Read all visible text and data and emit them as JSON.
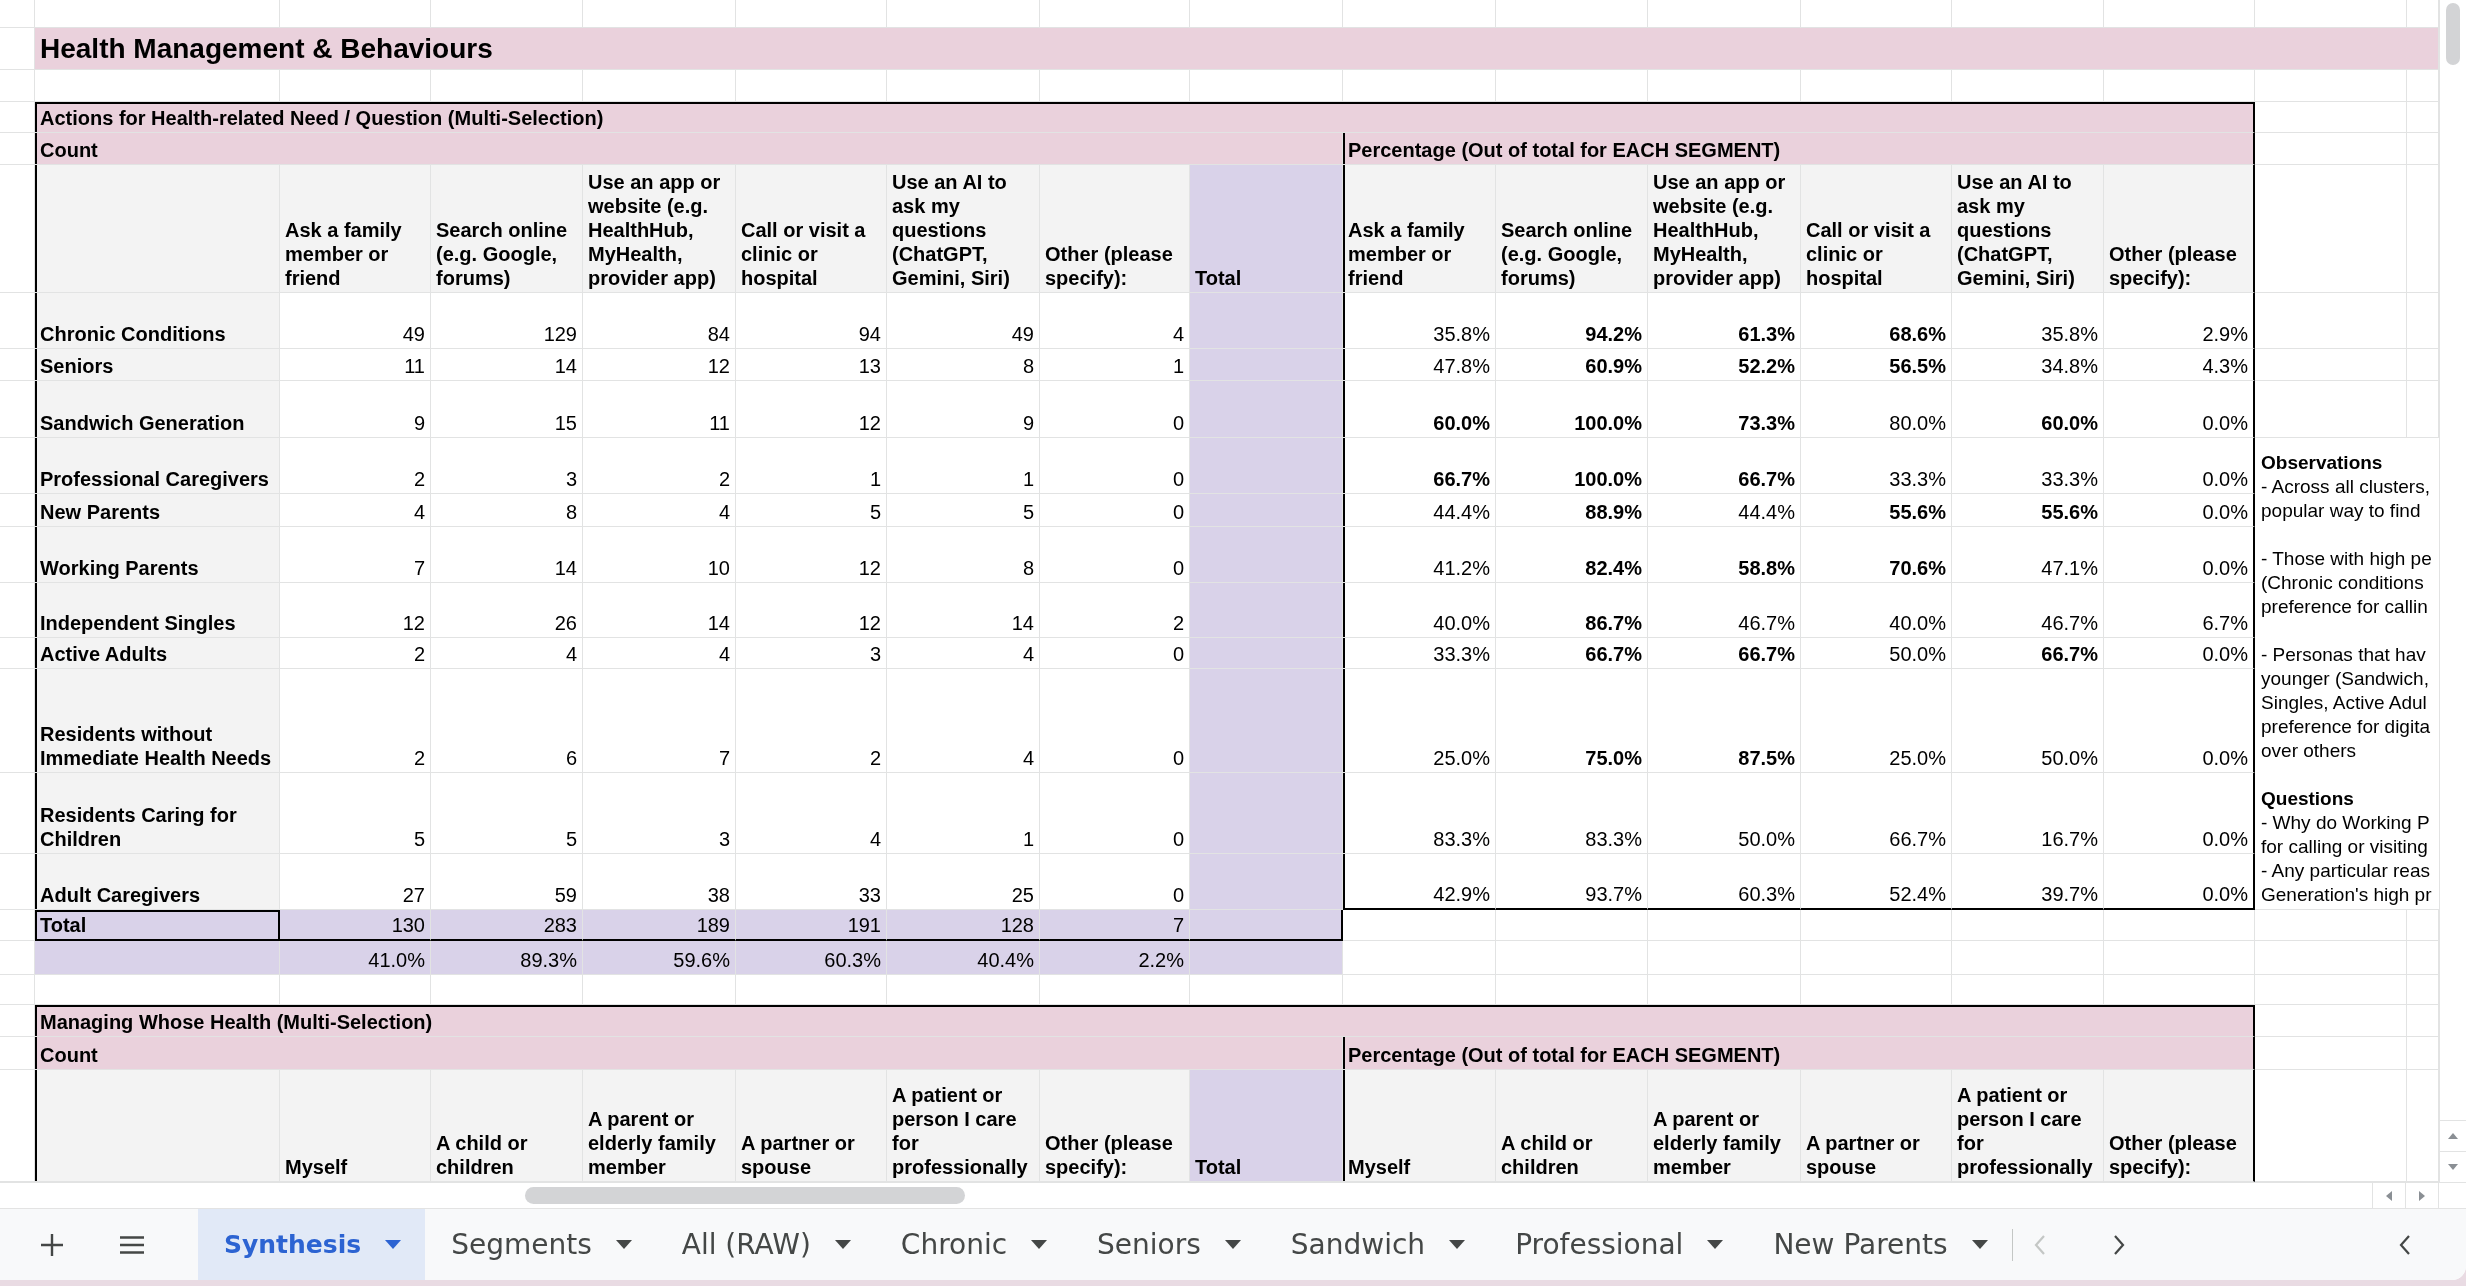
{
  "sheet": {
    "title": "Health Management & Behaviours",
    "tables": [
      {
        "title": "Actions for Health-related Need / Question (Multi-Selection)",
        "count_label": "Count",
        "percentage_label": "Percentage (Out of total for EACH SEGMENT)",
        "count_columns": [
          "Ask a family member or friend",
          "Search online (e.g. Google, forums)",
          "Use an app or website (e.g. HealthHub, MyHealth, provider app)",
          "Call or visit a clinic or hospital",
          "Use an AI to ask my questions (ChatGPT, Gemini, Siri)",
          "Other (please specify):"
        ],
        "total_column": "Total",
        "percentage_columns": [
          "Ask a family member or friend",
          "Search online (e.g. Google, forums)",
          "Use an app or website (e.g. HealthHub, MyHealth, provider app)",
          "Call or visit a clinic or hospital",
          "Use an AI to ask my questions (ChatGPT, Gemini, Siri)",
          "Other (please specify):"
        ],
        "rows": [
          {
            "segment": "Chronic Conditions",
            "counts": [
              "49",
              "129",
              "84",
              "94",
              "49",
              "4"
            ],
            "percentages": [
              {
                "value": "35.8%",
                "bold": false
              },
              {
                "value": "94.2%",
                "bold": true
              },
              {
                "value": "61.3%",
                "bold": true
              },
              {
                "value": "68.6%",
                "bold": true
              },
              {
                "value": "35.8%",
                "bold": false
              },
              {
                "value": "2.9%",
                "bold": false
              }
            ]
          },
          {
            "segment": "Seniors",
            "counts": [
              "11",
              "14",
              "12",
              "13",
              "8",
              "1"
            ],
            "percentages": [
              {
                "value": "47.8%",
                "bold": false
              },
              {
                "value": "60.9%",
                "bold": true
              },
              {
                "value": "52.2%",
                "bold": true
              },
              {
                "value": "56.5%",
                "bold": true
              },
              {
                "value": "34.8%",
                "bold": false
              },
              {
                "value": "4.3%",
                "bold": false
              }
            ]
          },
          {
            "segment": "Sandwich Generation",
            "counts": [
              "9",
              "15",
              "11",
              "12",
              "9",
              "0"
            ],
            "percentages": [
              {
                "value": "60.0%",
                "bold": true
              },
              {
                "value": "100.0%",
                "bold": true
              },
              {
                "value": "73.3%",
                "bold": true
              },
              {
                "value": "80.0%",
                "bold": false
              },
              {
                "value": "60.0%",
                "bold": true
              },
              {
                "value": "0.0%",
                "bold": false
              }
            ]
          },
          {
            "segment": "Professional Caregivers",
            "counts": [
              "2",
              "3",
              "2",
              "1",
              "1",
              "0"
            ],
            "percentages": [
              {
                "value": "66.7%",
                "bold": true
              },
              {
                "value": "100.0%",
                "bold": true
              },
              {
                "value": "66.7%",
                "bold": true
              },
              {
                "value": "33.3%",
                "bold": false
              },
              {
                "value": "33.3%",
                "bold": false
              },
              {
                "value": "0.0%",
                "bold": false
              }
            ]
          },
          {
            "segment": "New Parents",
            "counts": [
              "4",
              "8",
              "4",
              "5",
              "5",
              "0"
            ],
            "percentages": [
              {
                "value": "44.4%",
                "bold": false
              },
              {
                "value": "88.9%",
                "bold": true
              },
              {
                "value": "44.4%",
                "bold": false
              },
              {
                "value": "55.6%",
                "bold": true
              },
              {
                "value": "55.6%",
                "bold": true
              },
              {
                "value": "0.0%",
                "bold": false
              }
            ]
          },
          {
            "segment": "Working Parents",
            "counts": [
              "7",
              "14",
              "10",
              "12",
              "8",
              "0"
            ],
            "percentages": [
              {
                "value": "41.2%",
                "bold": false
              },
              {
                "value": "82.4%",
                "bold": true
              },
              {
                "value": "58.8%",
                "bold": true
              },
              {
                "value": "70.6%",
                "bold": true
              },
              {
                "value": "47.1%",
                "bold": false
              },
              {
                "value": "0.0%",
                "bold": false
              }
            ]
          },
          {
            "segment": "Independent Singles",
            "counts": [
              "12",
              "26",
              "14",
              "12",
              "14",
              "2"
            ],
            "percentages": [
              {
                "value": "40.0%",
                "bold": false
              },
              {
                "value": "86.7%",
                "bold": true
              },
              {
                "value": "46.7%",
                "bold": false
              },
              {
                "value": "40.0%",
                "bold": false
              },
              {
                "value": "46.7%",
                "bold": false
              },
              {
                "value": "6.7%",
                "bold": false
              }
            ]
          },
          {
            "segment": "Active Adults",
            "counts": [
              "2",
              "4",
              "4",
              "3",
              "4",
              "0"
            ],
            "percentages": [
              {
                "value": "33.3%",
                "bold": false
              },
              {
                "value": "66.7%",
                "bold": true
              },
              {
                "value": "66.7%",
                "bold": true
              },
              {
                "value": "50.0%",
                "bold": false
              },
              {
                "value": "66.7%",
                "bold": true
              },
              {
                "value": "0.0%",
                "bold": false
              }
            ]
          },
          {
            "segment": "Residents without Immediate Health Needs",
            "counts": [
              "2",
              "6",
              "7",
              "2",
              "4",
              "0"
            ],
            "percentages": [
              {
                "value": "25.0%",
                "bold": false
              },
              {
                "value": "75.0%",
                "bold": true
              },
              {
                "value": "87.5%",
                "bold": true
              },
              {
                "value": "25.0%",
                "bold": false
              },
              {
                "value": "50.0%",
                "bold": false
              },
              {
                "value": "0.0%",
                "bold": false
              }
            ]
          },
          {
            "segment": "Residents Caring for Children",
            "counts": [
              "5",
              "5",
              "3",
              "4",
              "1",
              "0"
            ],
            "percentages": [
              {
                "value": "83.3%",
                "bold": false
              },
              {
                "value": "83.3%",
                "bold": false
              },
              {
                "value": "50.0%",
                "bold": false
              },
              {
                "value": "66.7%",
                "bold": false
              },
              {
                "value": "16.7%",
                "bold": false
              },
              {
                "value": "0.0%",
                "bold": false
              }
            ]
          },
          {
            "segment": "Adult Caregivers",
            "counts": [
              "27",
              "59",
              "38",
              "33",
              "25",
              "0"
            ],
            "percentages": [
              {
                "value": "42.9%",
                "bold": false
              },
              {
                "value": "93.7%",
                "bold": false
              },
              {
                "value": "60.3%",
                "bold": false
              },
              {
                "value": "52.4%",
                "bold": false
              },
              {
                "value": "39.7%",
                "bold": false
              },
              {
                "value": "0.0%",
                "bold": false
              }
            ]
          }
        ],
        "total_row": {
          "label": "Total",
          "counts": [
            "130",
            "283",
            "189",
            "191",
            "128",
            "7"
          ]
        },
        "share_row": [
          "41.0%",
          "89.3%",
          "59.6%",
          "60.3%",
          "40.4%",
          "2.2%"
        ]
      },
      {
        "title": "Managing Whose Health (Multi-Selection)",
        "count_label": "Count",
        "percentage_label": "Percentage (Out of total for EACH SEGMENT)",
        "count_columns": [
          "Myself",
          "A child or children",
          "A parent or elderly family member",
          "A partner or spouse",
          "A patient or person I care for professionally",
          "Other (please specify):"
        ],
        "total_column": "Total",
        "percentage_columns": [
          "Myself",
          "A child or children",
          "A parent or elderly family member",
          "A partner or spouse",
          "A patient or person I care for professionally",
          "Other (please specify):"
        ]
      }
    ],
    "notes": [
      {
        "heading": "Observations",
        "paragraphs": [
          [
            "- Across all clusters,",
            "popular way to find"
          ],
          [
            "- Those with high pe",
            "(Chronic conditions",
            "preference for callin"
          ],
          [
            "- Personas that hav",
            "younger (Sandwich,",
            "Singles, Active Adul",
            "preference for digita",
            "over others"
          ]
        ]
      },
      {
        "heading": "Questions",
        "paragraphs": [
          [
            "- Why do Working P",
            "for calling or visiting",
            "- Any particular reas",
            "Generation's high pr"
          ]
        ]
      }
    ]
  },
  "sheet_tabs": [
    {
      "label": "Synthesis",
      "selected": true
    },
    {
      "label": "Segments",
      "selected": false
    },
    {
      "label": "All (RAW)",
      "selected": false
    },
    {
      "label": "Chronic",
      "selected": false
    },
    {
      "label": "Seniors",
      "selected": false
    },
    {
      "label": "Sandwich",
      "selected": false
    },
    {
      "label": "Professional",
      "selected": false
    },
    {
      "label": "New Parents",
      "selected": false
    }
  ],
  "tab_scroll": [
    {
      "kind": "previous",
      "disabled": true
    },
    {
      "kind": "next",
      "disabled": false
    }
  ]
}
